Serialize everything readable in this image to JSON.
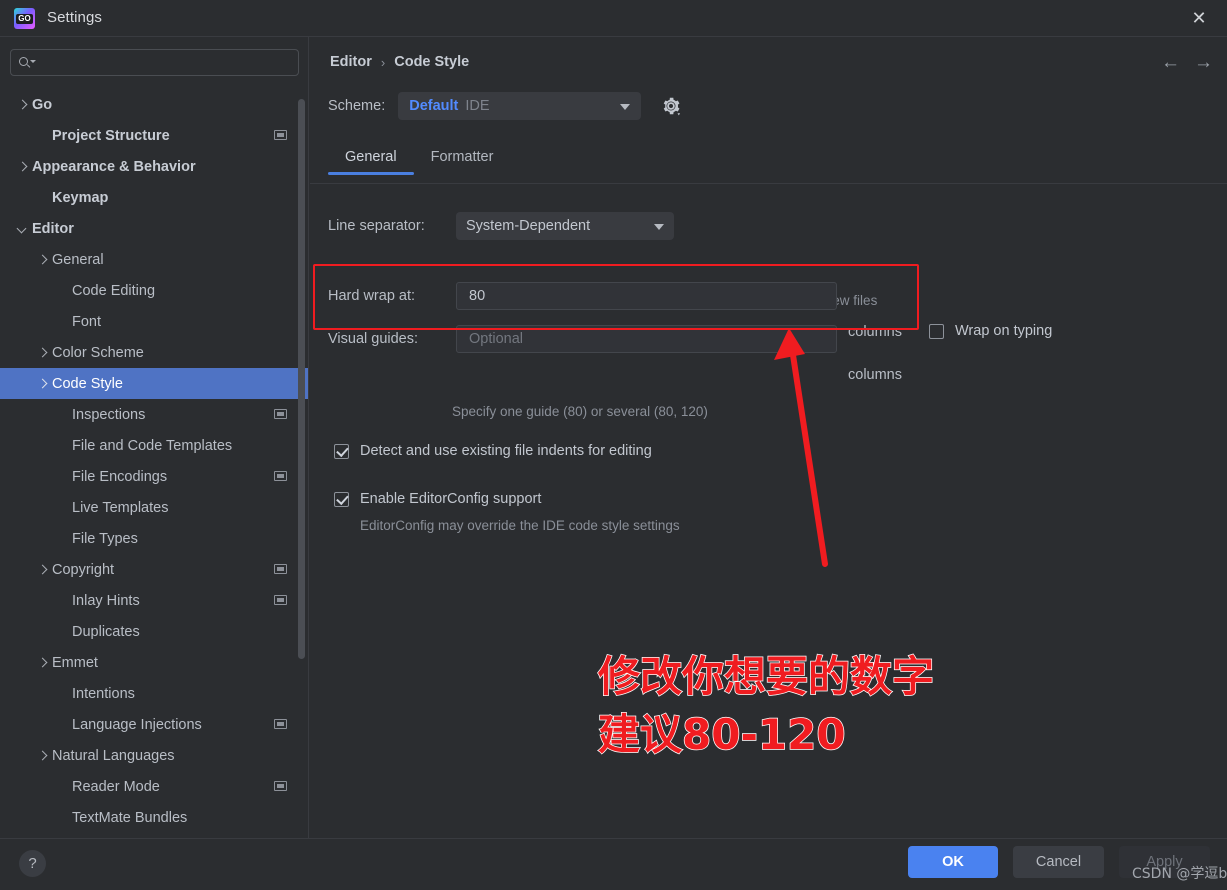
{
  "window": {
    "title": "Settings",
    "logo_glyph": "GO",
    "close_label": "✕"
  },
  "search": {
    "value": "",
    "placeholder": ""
  },
  "sidebar": {
    "items": [
      {
        "label": "Go",
        "indent": 0,
        "arrow": "right",
        "bold": true,
        "badge": false,
        "selected": false
      },
      {
        "label": "Project Structure",
        "indent": 1,
        "arrow": "none",
        "bold": true,
        "badge": true,
        "selected": false
      },
      {
        "label": "Appearance & Behavior",
        "indent": 0,
        "arrow": "right",
        "bold": true,
        "badge": false,
        "selected": false
      },
      {
        "label": "Keymap",
        "indent": 1,
        "arrow": "none",
        "bold": true,
        "badge": false,
        "selected": false
      },
      {
        "label": "Editor",
        "indent": 0,
        "arrow": "down",
        "bold": true,
        "badge": false,
        "selected": false
      },
      {
        "label": "General",
        "indent": 1,
        "arrow": "right",
        "bold": false,
        "badge": false,
        "selected": false
      },
      {
        "label": "Code Editing",
        "indent": 2,
        "arrow": "none",
        "bold": false,
        "badge": false,
        "selected": false
      },
      {
        "label": "Font",
        "indent": 2,
        "arrow": "none",
        "bold": false,
        "badge": false,
        "selected": false
      },
      {
        "label": "Color Scheme",
        "indent": 1,
        "arrow": "right",
        "bold": false,
        "badge": false,
        "selected": false
      },
      {
        "label": "Code Style",
        "indent": 1,
        "arrow": "right",
        "bold": false,
        "badge": false,
        "selected": true
      },
      {
        "label": "Inspections",
        "indent": 2,
        "arrow": "none",
        "bold": false,
        "badge": true,
        "selected": false
      },
      {
        "label": "File and Code Templates",
        "indent": 2,
        "arrow": "none",
        "bold": false,
        "badge": false,
        "selected": false
      },
      {
        "label": "File Encodings",
        "indent": 2,
        "arrow": "none",
        "bold": false,
        "badge": true,
        "selected": false
      },
      {
        "label": "Live Templates",
        "indent": 2,
        "arrow": "none",
        "bold": false,
        "badge": false,
        "selected": false
      },
      {
        "label": "File Types",
        "indent": 2,
        "arrow": "none",
        "bold": false,
        "badge": false,
        "selected": false
      },
      {
        "label": "Copyright",
        "indent": 1,
        "arrow": "right",
        "bold": false,
        "badge": true,
        "selected": false
      },
      {
        "label": "Inlay Hints",
        "indent": 2,
        "arrow": "none",
        "bold": false,
        "badge": true,
        "selected": false
      },
      {
        "label": "Duplicates",
        "indent": 2,
        "arrow": "none",
        "bold": false,
        "badge": false,
        "selected": false
      },
      {
        "label": "Emmet",
        "indent": 1,
        "arrow": "right",
        "bold": false,
        "badge": false,
        "selected": false
      },
      {
        "label": "Intentions",
        "indent": 2,
        "arrow": "none",
        "bold": false,
        "badge": false,
        "selected": false
      },
      {
        "label": "Language Injections",
        "indent": 2,
        "arrow": "none",
        "bold": false,
        "badge": true,
        "selected": false
      },
      {
        "label": "Natural Languages",
        "indent": 1,
        "arrow": "right",
        "bold": false,
        "badge": false,
        "selected": false
      },
      {
        "label": "Reader Mode",
        "indent": 2,
        "arrow": "none",
        "bold": false,
        "badge": true,
        "selected": false
      },
      {
        "label": "TextMate Bundles",
        "indent": 2,
        "arrow": "none",
        "bold": false,
        "badge": false,
        "selected": false
      }
    ]
  },
  "main": {
    "breadcrumb": {
      "parent": "Editor",
      "separator": "›",
      "current": "Code Style"
    },
    "nav": {
      "back": "←",
      "forward": "→"
    },
    "scheme": {
      "label": "Scheme:",
      "value": "Default",
      "suffix": "IDE"
    },
    "tabs": [
      {
        "label": "General",
        "active": true
      },
      {
        "label": "Formatter",
        "active": false
      }
    ],
    "line_separator": {
      "label": "Line separator:",
      "value": "System-Dependent",
      "hint": "Applied to new files"
    },
    "hard_wrap": {
      "label": "Hard wrap at:",
      "value": "80",
      "unit": "columns"
    },
    "wrap_on_typing": {
      "label": "Wrap on typing",
      "checked": false
    },
    "visual_guides": {
      "label": "Visual guides:",
      "value": "",
      "placeholder": "Optional",
      "unit": "columns",
      "hint": "Specify one guide (80) or several (80, 120)"
    },
    "detect_indents": {
      "label": "Detect and use existing file indents for editing",
      "checked": true
    },
    "editorconfig": {
      "label": "Enable EditorConfig support",
      "checked": true,
      "hint": "EditorConfig may override the IDE code style settings"
    }
  },
  "annotations": {
    "chinese_note": "修改你想要的数字\n建议80-120",
    "highlight_color": "#f01c20",
    "watermark": "CSDN @学逗b"
  },
  "footer": {
    "help": "?",
    "ok": "OK",
    "cancel": "Cancel",
    "apply": "Apply"
  },
  "colors": {
    "background": "#2b2d30",
    "selection_blue": "#4f73c4",
    "accent_blue": "#4a82f0",
    "link_blue": "#528bff",
    "annotation_red": "#f01c20"
  }
}
